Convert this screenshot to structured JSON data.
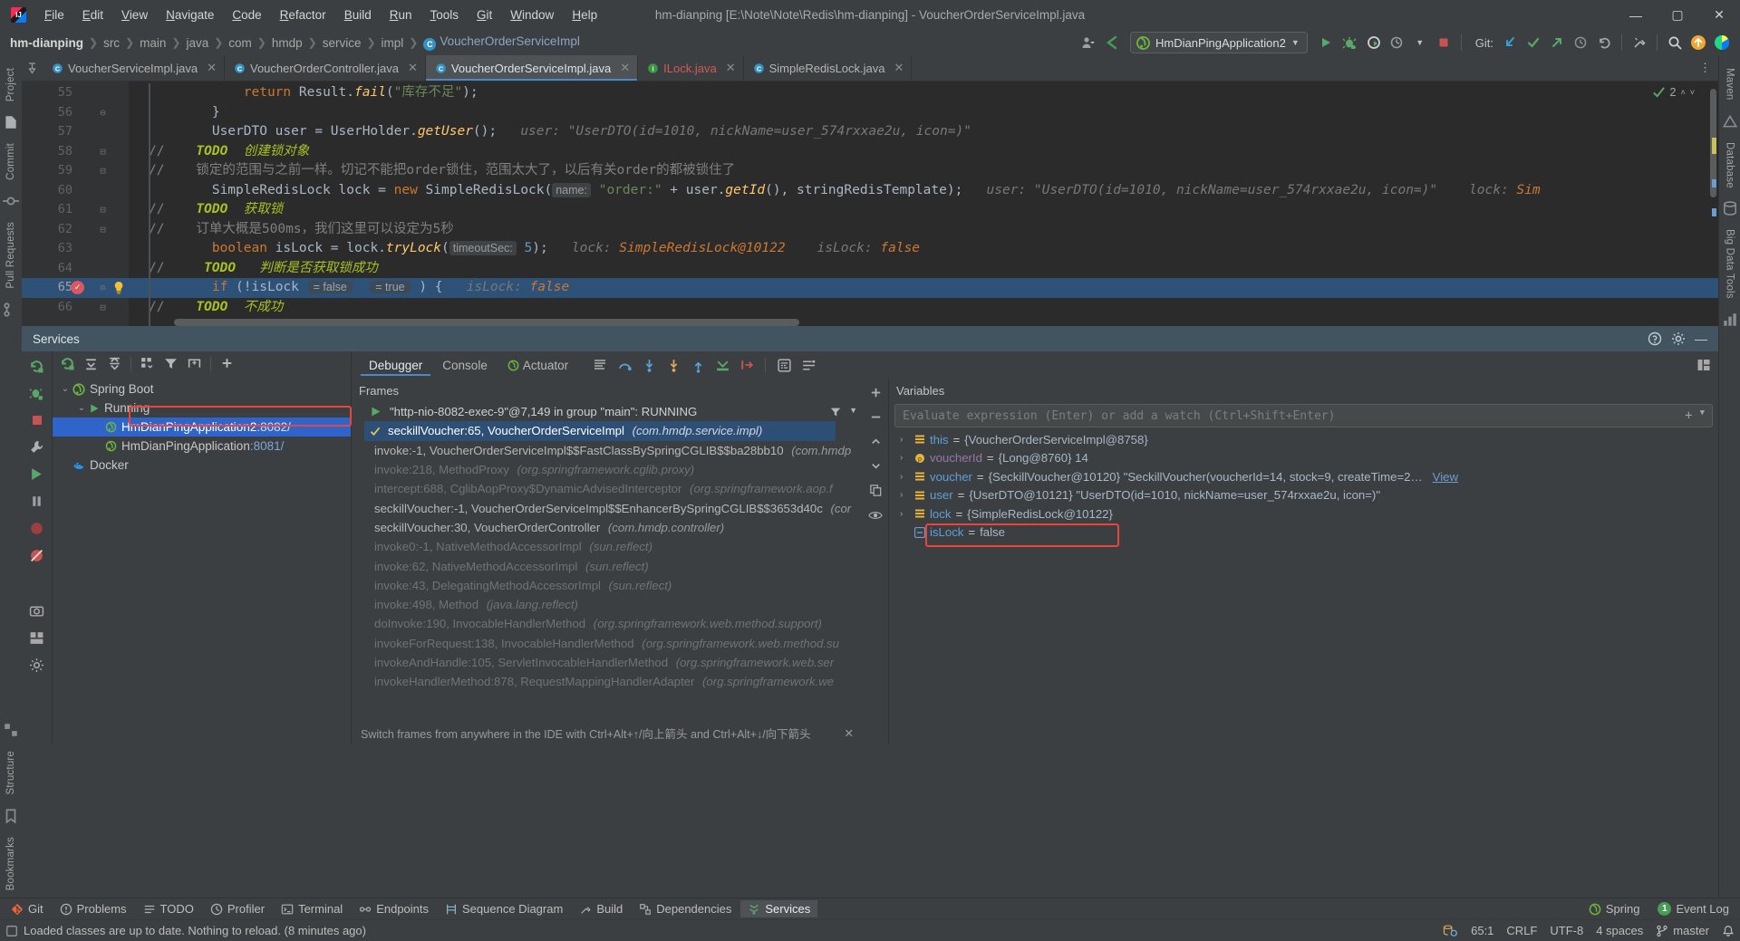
{
  "window": {
    "title": "hm-dianping [E:\\Note\\Note\\Redis\\hm-dianping] - VoucherOrderServiceImpl.java",
    "minimize": "—",
    "maximize": "▢",
    "close": "✕"
  },
  "menubar": [
    {
      "label": "File"
    },
    {
      "label": "Edit"
    },
    {
      "label": "View"
    },
    {
      "label": "Navigate"
    },
    {
      "label": "Code"
    },
    {
      "label": "Refactor"
    },
    {
      "label": "Build"
    },
    {
      "label": "Run"
    },
    {
      "label": "Tools"
    },
    {
      "label": "Git"
    },
    {
      "label": "Window"
    },
    {
      "label": "Help"
    }
  ],
  "breadcrumbs": [
    {
      "label": "hm-dianping",
      "style": "bold"
    },
    {
      "label": "src",
      "style": "dim"
    },
    {
      "label": "main",
      "style": "dim"
    },
    {
      "label": "java",
      "style": "dim"
    },
    {
      "label": "com",
      "style": "dim"
    },
    {
      "label": "hmdp",
      "style": "dim"
    },
    {
      "label": "service",
      "style": "dim"
    },
    {
      "label": "impl",
      "style": "dim"
    },
    {
      "label": "VoucherOrderServiceImpl",
      "style": "class"
    }
  ],
  "toolbar": {
    "run_config": "HmDianPingApplication2",
    "git_label": "Git:",
    "sep": "›"
  },
  "editor_tabs": [
    {
      "label": "VoucherServiceImpl.java",
      "active": false,
      "error": false
    },
    {
      "label": "VoucherOrderController.java",
      "active": false,
      "error": false
    },
    {
      "label": "VoucherOrderServiceImpl.java",
      "active": true,
      "error": false
    },
    {
      "label": "ILock.java",
      "active": false,
      "error": true
    },
    {
      "label": "SimpleRedisLock.java",
      "active": false,
      "error": false
    }
  ],
  "inspection_widget": {
    "count": "2"
  },
  "code": {
    "lines": [
      {
        "number": "55",
        "fold": "",
        "tokens": [
          {
            "t": "            ",
            "c": "id"
          },
          {
            "t": "return",
            "c": "kw"
          },
          {
            "t": " Result.",
            "c": "id"
          },
          {
            "t": "fail",
            "c": "mth"
          },
          {
            "t": "(",
            "c": "id"
          },
          {
            "t": "\"库存不足\"",
            "c": "str"
          },
          {
            "t": ");",
            "c": "id"
          }
        ]
      },
      {
        "number": "56",
        "fold": "⊖",
        "tokens": [
          {
            "t": "        }",
            "c": "id"
          }
        ]
      },
      {
        "number": "57",
        "fold": "",
        "tokens": [
          {
            "t": "        UserDTO user = UserHolder.",
            "c": "id"
          },
          {
            "t": "getUser",
            "c": "mth"
          },
          {
            "t": "();",
            "c": "id"
          },
          {
            "t": "   user: ",
            "c": "hintval"
          },
          {
            "t": "\"UserDTO(id=1010, nickName=user_574rxxae2u, icon=)\"",
            "c": "hintval"
          }
        ]
      },
      {
        "number": "58",
        "fold": "⊟",
        "comment_slash": "//",
        "tokens": [
          {
            "t": "    ",
            "c": "id"
          },
          {
            "t": "TODO",
            "c": "todo"
          },
          {
            "t": "  创建锁对象",
            "c": "todoc"
          }
        ]
      },
      {
        "number": "59",
        "fold": "⊟",
        "comment_slash": "//",
        "tokens": [
          {
            "t": "    锁定的范围与之前一样。切记不能把order锁住，范围太大了，以后有关order的都被锁住了",
            "c": "cmt"
          }
        ]
      },
      {
        "number": "60",
        "fold": "",
        "tokens": [
          {
            "t": "        SimpleRedisLock lock = ",
            "c": "id"
          },
          {
            "t": "new",
            "c": "kw"
          },
          {
            "t": " SimpleRedisLock(",
            "c": "id"
          },
          {
            "t": "name:",
            "c": "param"
          },
          {
            "t": " ",
            "c": "id"
          },
          {
            "t": "\"order:\"",
            "c": "str"
          },
          {
            "t": " + user.",
            "c": "id"
          },
          {
            "t": "getId",
            "c": "mth"
          },
          {
            "t": "(), stringRedisTemplate);",
            "c": "id"
          },
          {
            "t": "   user: ",
            "c": "hintval"
          },
          {
            "t": "\"UserDTO(id=1010, nickName=user_574rxxae2u, icon=)\"",
            "c": "hintval"
          },
          {
            "t": "    lock: ",
            "c": "hintval"
          },
          {
            "t": "Sim",
            "c": "orng"
          }
        ]
      },
      {
        "number": "61",
        "fold": "⊟",
        "comment_slash": "//",
        "tokens": [
          {
            "t": "    ",
            "c": "id"
          },
          {
            "t": "TODO",
            "c": "todo"
          },
          {
            "t": "  获取锁",
            "c": "todoc"
          }
        ]
      },
      {
        "number": "62",
        "fold": "⊟",
        "comment_slash": "//",
        "tokens": [
          {
            "t": "    订单大概是500ms，我们这里可以设定为5秒",
            "c": "cmt"
          }
        ]
      },
      {
        "number": "63",
        "fold": "",
        "tokens": [
          {
            "t": "        ",
            "c": "id"
          },
          {
            "t": "boolean",
            "c": "kw"
          },
          {
            "t": " isLock = lock.",
            "c": "id"
          },
          {
            "t": "tryLock",
            "c": "mth"
          },
          {
            "t": "(",
            "c": "id"
          },
          {
            "t": "timeoutSec:",
            "c": "param"
          },
          {
            "t": " ",
            "c": "id"
          },
          {
            "t": "5",
            "c": "num2"
          },
          {
            "t": ");",
            "c": "id"
          },
          {
            "t": "   lock: ",
            "c": "hintval"
          },
          {
            "t": "SimpleRedisLock@10122",
            "c": "orng"
          },
          {
            "t": "    isLock: ",
            "c": "hintval"
          },
          {
            "t": "false",
            "c": "orng"
          }
        ]
      },
      {
        "number": "64",
        "fold": "",
        "comment_slash": "//",
        "tokens": [
          {
            "t": "     ",
            "c": "id"
          },
          {
            "t": "TODO",
            "c": "todo"
          },
          {
            "t": "   判断是否获取锁成功",
            "c": "todoc"
          }
        ]
      },
      {
        "number": "65",
        "fold": "⊜",
        "current": true,
        "breakpoint": true,
        "bulb": true,
        "tokens": [
          {
            "t": "        ",
            "c": "id"
          },
          {
            "t": "if",
            "c": "kw"
          },
          {
            "t": " (!isLock ",
            "c": "id"
          },
          {
            "t": "= false",
            "c": "inlay"
          },
          {
            "t": "  ",
            "c": "id"
          },
          {
            "t": "= true",
            "c": "inlay"
          },
          {
            "t": " ) {",
            "c": "id"
          },
          {
            "t": "   isLock: ",
            "c": "hintval"
          },
          {
            "t": "false",
            "c": "orng"
          }
        ]
      },
      {
        "number": "66",
        "fold": "⊟",
        "comment_slash": "//",
        "tokens": [
          {
            "t": "    ",
            "c": "id"
          },
          {
            "t": "TODO",
            "c": "todo"
          },
          {
            "t": "  不成功",
            "c": "todoc"
          }
        ]
      }
    ]
  },
  "services": {
    "title": "Services",
    "tree_toolbar": [
      "rerun-icon",
      "expand-all-icon",
      "collapse-all-icon",
      "group-icon",
      "filter-icon",
      "add-frame-icon",
      "add-icon"
    ],
    "tree": [
      {
        "label": "Spring Boot",
        "indent": 0,
        "arrow": "⌄",
        "icon": "spring-icon",
        "selected": false,
        "port": ""
      },
      {
        "label": "Running",
        "indent": 1,
        "arrow": "⌄",
        "icon": "run-icon",
        "selected": false,
        "port": ""
      },
      {
        "label": "HmDianPingApplication2",
        "indent": 2,
        "arrow": "",
        "icon": "spring-boot-app-icon",
        "selected": true,
        "port": " :8082/"
      },
      {
        "label": "HmDianPingApplication",
        "indent": 2,
        "arrow": "",
        "icon": "spring-boot-app-icon",
        "selected": false,
        "port": " :8081/"
      },
      {
        "label": "Docker",
        "indent": 0,
        "arrow": "",
        "icon": "docker-icon",
        "selected": false,
        "port": ""
      }
    ]
  },
  "debugger": {
    "tabs": [
      {
        "label": "Debugger",
        "active": true
      },
      {
        "label": "Console",
        "active": false
      },
      {
        "label": "Actuator",
        "active": false,
        "icon": "actuator-icon"
      }
    ],
    "frames_header": "Frames",
    "thread": "\"http-nio-8082-exec-9\"@7,149 in group \"main\": RUNNING",
    "frames": [
      {
        "method": "seckillVoucher:65, VoucherOrderServiceImpl",
        "pkg": "(com.hmdp.service.impl)",
        "current": true,
        "dim": false
      },
      {
        "method": "invoke:-1, VoucherOrderServiceImpl$$FastClassBySpringCGLIB$$ba28bb10",
        "pkg": "(com.hmdp",
        "current": false,
        "dim": false
      },
      {
        "method": "invoke:218, MethodProxy",
        "pkg": "(org.springframework.cglib.proxy)",
        "current": false,
        "dim": true
      },
      {
        "method": "intercept:688, CglibAopProxy$DynamicAdvisedInterceptor",
        "pkg": "(org.springframework.aop.f",
        "current": false,
        "dim": true
      },
      {
        "method": "seckillVoucher:-1, VoucherOrderServiceImpl$$EnhancerBySpringCGLIB$$3653d40c",
        "pkg": "(cor",
        "current": false,
        "dim": false
      },
      {
        "method": "seckillVoucher:30, VoucherOrderController",
        "pkg": "(com.hmdp.controller)",
        "current": false,
        "dim": false
      },
      {
        "method": "invoke0:-1, NativeMethodAccessorImpl",
        "pkg": "(sun.reflect)",
        "current": false,
        "dim": true
      },
      {
        "method": "invoke:62, NativeMethodAccessorImpl",
        "pkg": "(sun.reflect)",
        "current": false,
        "dim": true
      },
      {
        "method": "invoke:43, DelegatingMethodAccessorImpl",
        "pkg": "(sun.reflect)",
        "current": false,
        "dim": true
      },
      {
        "method": "invoke:498, Method",
        "pkg": "(java.lang.reflect)",
        "current": false,
        "dim": true
      },
      {
        "method": "doInvoke:190, InvocableHandlerMethod",
        "pkg": "(org.springframework.web.method.support)",
        "current": false,
        "dim": true
      },
      {
        "method": "invokeForRequest:138, InvocableHandlerMethod",
        "pkg": "(org.springframework.web.method.su",
        "current": false,
        "dim": true
      },
      {
        "method": "invokeAndHandle:105, ServletInvocableHandlerMethod",
        "pkg": "(org.springframework.web.ser",
        "current": false,
        "dim": true
      },
      {
        "method": "invokeHandlerMethod:878, RequestMappingHandlerAdapter",
        "pkg": "(org.springframework.we",
        "current": false,
        "dim": true
      }
    ],
    "frames_hint": "Switch frames from anywhere in the IDE with Ctrl+Alt+↑/向上箭头 and Ctrl+Alt+↓/向下箭头",
    "variables_header": "Variables",
    "eval_placeholder": "Evaluate expression (Enter) or add a watch (Ctrl+Shift+Enter)",
    "variables": [
      {
        "name": "this",
        "eq": "=",
        "value": "{VoucherOrderServiceImpl@8758}",
        "vclass": "vval-obj",
        "nclass": "vname blue",
        "arrow": "›",
        "icon": "field-icon",
        "highlight": false
      },
      {
        "name": "voucherId",
        "eq": "=",
        "value": "{Long@8760} 14",
        "vclass": "vval-obj",
        "nclass": "vname",
        "arrow": "›",
        "icon": "param-icon",
        "highlight": false
      },
      {
        "name": "voucher",
        "eq": "=",
        "value": "{SeckillVoucher@10120} \"SeckillVoucher(voucherId=14, stock=9, createTime=2…",
        "vclass": "vval-obj",
        "nclass": "vname blue",
        "arrow": "›",
        "icon": "local-icon",
        "highlight": false,
        "link": "View"
      },
      {
        "name": "user",
        "eq": "=",
        "value": "{UserDTO@10121} \"UserDTO(id=1010, nickName=user_574rxxae2u, icon=)\"",
        "vclass": "vval-obj",
        "nclass": "vname blue",
        "arrow": "›",
        "icon": "local-icon",
        "highlight": false
      },
      {
        "name": "lock",
        "eq": "=",
        "value": "{SimpleRedisLock@10122}",
        "vclass": "vval-obj",
        "nclass": "vname blue",
        "arrow": "›",
        "icon": "local-icon",
        "highlight": false
      },
      {
        "name": "isLock",
        "eq": "=",
        "value": "false",
        "vclass": "vval-obj",
        "nclass": "vname blue",
        "arrow": "",
        "icon": "bool-icon",
        "highlight": true
      }
    ]
  },
  "bottom_bar": {
    "left": [
      {
        "label": "Git",
        "icon": "git-icon",
        "active": false
      },
      {
        "label": "Problems",
        "icon": "problems-icon",
        "active": false
      },
      {
        "label": "TODO",
        "icon": "todo-icon",
        "active": false
      },
      {
        "label": "Profiler",
        "icon": "profiler-icon",
        "active": false
      },
      {
        "label": "Terminal",
        "icon": "terminal-icon",
        "active": false
      },
      {
        "label": "Endpoints",
        "icon": "endpoints-icon",
        "active": false
      },
      {
        "label": "Sequence Diagram",
        "icon": "sequence-icon",
        "active": false
      },
      {
        "label": "Build",
        "icon": "build-icon",
        "active": false
      },
      {
        "label": "Dependencies",
        "icon": "dependencies-icon",
        "active": false
      },
      {
        "label": "Services",
        "icon": "services-icon",
        "active": true
      }
    ],
    "right": [
      {
        "label": "Spring",
        "icon": "spring-icon"
      },
      {
        "label": "Event Log",
        "icon": "event-log-icon",
        "badge": "1"
      }
    ]
  },
  "statusbar": {
    "message": "Loaded classes are up to date. Nothing to reload. (8 minutes ago)",
    "caret": "65:1",
    "line_sep": "CRLF",
    "encoding": "UTF-8",
    "indent": "4 spaces",
    "branch": "master"
  },
  "rail_left": [
    "Project",
    "Commit",
    "Pull Requests",
    "Structure",
    "Bookmarks"
  ],
  "rail_right": [
    "Maven",
    "Database",
    "Big Data Tools"
  ],
  "colors": {
    "accent_blue": "#2f65ca",
    "highlight_red": "#e8453c",
    "editor_bg": "#2b2b2b",
    "panel_bg": "#3c3f41",
    "selection": "#2d5177"
  }
}
